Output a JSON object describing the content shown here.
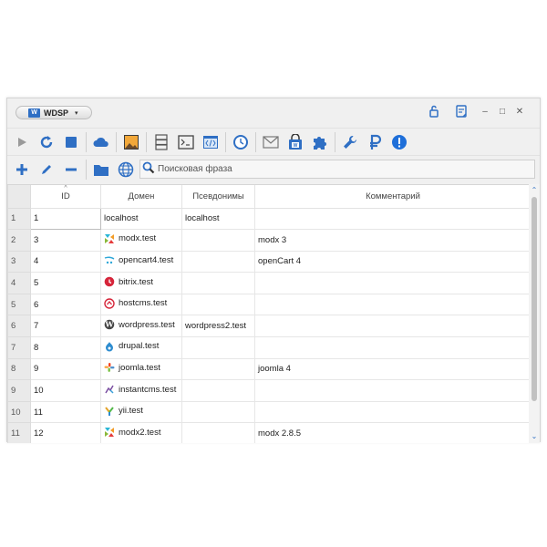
{
  "app": {
    "logo_letter": "W",
    "name": "WDSP",
    "combo_arrow": "▾"
  },
  "window_controls": {
    "minimize": "–",
    "maximize": "□",
    "close": "✕"
  },
  "titlebar_icons": [
    "unlock-icon",
    "notes-icon"
  ],
  "toolbar1_icons": [
    "play-icon",
    "restart-icon",
    "stop-icon",
    "cloud-icon",
    "image-icon",
    "server-icon",
    "terminal-icon",
    "code-icon",
    "clock-icon",
    "mail-icon",
    "wdsp-bag-icon",
    "puzzle-icon",
    "wrench-icon",
    "ruble-icon",
    "alert-icon"
  ],
  "toolbar2_icons": [
    "add-icon",
    "edit-icon",
    "remove-icon",
    "folder-icon",
    "globe-icon"
  ],
  "search": {
    "placeholder": "Поисковая фраза",
    "value": ""
  },
  "table": {
    "sort_mark": "^",
    "columns": {
      "id": "ID",
      "domain": "Домен",
      "aliases": "Псевдонимы",
      "comment": "Комментарий"
    },
    "rows": [
      {
        "n": "1",
        "id": "1",
        "domain": "localhost",
        "icon": "none",
        "aliases": "localhost",
        "comment": ""
      },
      {
        "n": "2",
        "id": "3",
        "domain": "modx.test",
        "icon": "modx-icon",
        "aliases": "",
        "comment": "modx 3"
      },
      {
        "n": "3",
        "id": "4",
        "domain": "opencart4.test",
        "icon": "opencart-icon",
        "aliases": "",
        "comment": "openCart 4"
      },
      {
        "n": "4",
        "id": "5",
        "domain": "bitrix.test",
        "icon": "bitrix-icon",
        "aliases": "",
        "comment": ""
      },
      {
        "n": "5",
        "id": "6",
        "domain": "hostcms.test",
        "icon": "hostcms-icon",
        "aliases": "",
        "comment": ""
      },
      {
        "n": "6",
        "id": "7",
        "domain": "wordpress.test",
        "icon": "wordpress-icon",
        "aliases": "wordpress2.test",
        "comment": ""
      },
      {
        "n": "7",
        "id": "8",
        "domain": "drupal.test",
        "icon": "drupal-icon",
        "aliases": "",
        "comment": ""
      },
      {
        "n": "8",
        "id": "9",
        "domain": "joomla.test",
        "icon": "joomla-icon",
        "aliases": "",
        "comment": "joomla 4"
      },
      {
        "n": "9",
        "id": "10",
        "domain": "instantcms.test",
        "icon": "instantcms-icon",
        "aliases": "",
        "comment": ""
      },
      {
        "n": "10",
        "id": "11",
        "domain": "yii.test",
        "icon": "yii-icon",
        "aliases": "",
        "comment": ""
      },
      {
        "n": "11",
        "id": "12",
        "domain": "modx2.test",
        "icon": "modx-icon",
        "aliases": "",
        "comment": "modx 2.8.5"
      }
    ]
  },
  "scrollbar": {
    "up": "⌃",
    "down": "⌄"
  },
  "colors": {
    "accent": "#2f6fc4",
    "bitrix": "#d6253a",
    "hostcms": "#d6253a",
    "wordpress": "#464646",
    "drupal": "#2d8ccf",
    "alert": "#1e6fd9"
  }
}
